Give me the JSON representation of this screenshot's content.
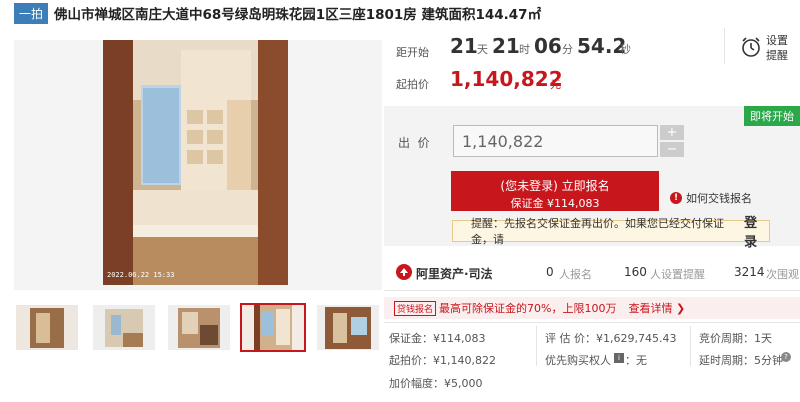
{
  "title": {
    "tag": "一拍",
    "text": "佛山市禅城区南庄大道中68号绿岛明珠花园1区三座1801房 建筑面积144.47㎡"
  },
  "photo": {
    "timestamp": "2022.06.22 15:33"
  },
  "countdown": {
    "label": "距开始",
    "days": "21",
    "days_unit": "天",
    "hours": "21",
    "hours_unit": "时",
    "minutes": "06",
    "minutes_unit": "分",
    "seconds": "54.2",
    "seconds_unit": "秒",
    "reminder_line1": "设置",
    "reminder_line2": "提醒"
  },
  "start_price": {
    "label": "起拍价",
    "value": "1,140,822",
    "unit": "元"
  },
  "bid": {
    "status_badge": "即将开始",
    "label": "出  价",
    "input_value": "1,140,822",
    "plus": "+",
    "minus": "−",
    "signup_line1": "(您未登录) 立即报名",
    "signup_line2": "保证金 ¥114,083",
    "howto": "如何交钱报名",
    "tip_text": "提醒：先报名交保证金再出价。如果您已经交付保证金，请",
    "tip_link": "登录"
  },
  "platform": {
    "logo_text": "阿里资产·司法",
    "signups": "0",
    "signups_label": "人报名",
    "reminders": "160",
    "reminders_label": "人设置提醒",
    "views": "3214",
    "views_label": "次围观"
  },
  "promo": {
    "badge": "贷钱报名",
    "text": "最高可除保证金的70%，上限100万",
    "link": "查看详情 ❯"
  },
  "details": {
    "deposit": "保证金：¥114,083",
    "appraisal": "评 估 价：¥1,629,745.43",
    "cycle": "竞价周期：1天",
    "start_price": "起拍价：¥1,140,822",
    "priority_label": "优先购买权人",
    "priority_value": "：无",
    "delay": "延时周期：5分钟",
    "increment": "加价幅度：¥5,000"
  },
  "colors": {
    "accent": "#c8161d",
    "tag": "#3c7fb8",
    "badge": "#2aa84a"
  }
}
